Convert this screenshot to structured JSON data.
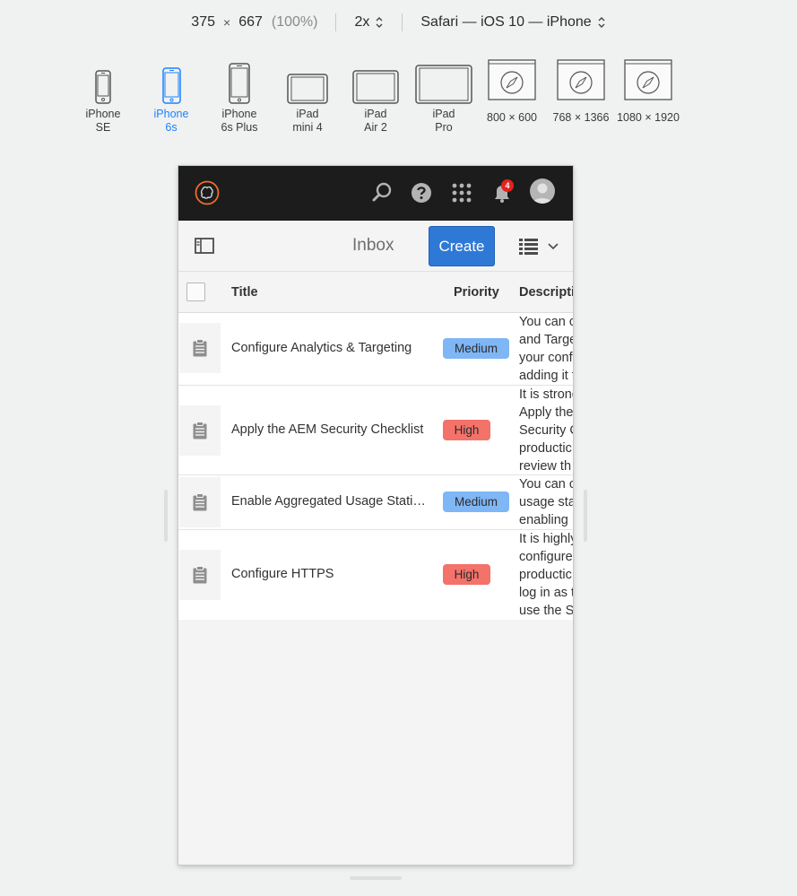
{
  "rdm": {
    "width": "375",
    "x": "×",
    "height": "667",
    "zoom": "(100%)",
    "pixel_ratio": "2x",
    "user_agent": "Safari — iOS 10 — iPhone"
  },
  "devices": [
    {
      "line1": "iPhone",
      "line2": "SE"
    },
    {
      "line1": "iPhone",
      "line2": "6s"
    },
    {
      "line1": "iPhone",
      "line2": "6s Plus"
    },
    {
      "line1": "iPad",
      "line2": "mini 4"
    },
    {
      "line1": "iPad",
      "line2": "Air 2"
    },
    {
      "line1": "iPad",
      "line2": "Pro"
    },
    {
      "line1": "800 × 600",
      "line2": ""
    },
    {
      "line1": "768 × 1366",
      "line2": ""
    },
    {
      "line1": "1080 × 1920",
      "line2": ""
    }
  ],
  "shell": {
    "notification_count": "4"
  },
  "actionbar": {
    "title": "Inbox",
    "create_label": "Create"
  },
  "table": {
    "headers": {
      "title": "Title",
      "priority": "Priority",
      "description": "Descripti"
    },
    "rows": [
      {
        "title": "Configure Analytics & Targeting",
        "priority": "Medium",
        "desc": [
          "You can c",
          "and Targe",
          "your conf",
          "adding it t"
        ]
      },
      {
        "title": "Apply the AEM Security Checklist",
        "priority": "High",
        "desc": [
          "It is strong",
          "Apply the",
          "Security C",
          "productic",
          "review th"
        ]
      },
      {
        "title": "Enable Aggregated Usage Statistic...",
        "priority": "Medium",
        "desc": [
          "You can c",
          "usage stat",
          "enabling"
        ]
      },
      {
        "title": "Configure HTTPS",
        "priority": "High",
        "desc": [
          "It is highly",
          "configure",
          "productic",
          "log in as t",
          "use the SS"
        ]
      }
    ]
  },
  "colors": {
    "active_device": "#1a82ff",
    "shell_bg": "#1c1c1c",
    "create_button": "#2f79d6",
    "medium": "#7fb6f5",
    "high": "#f3726a",
    "badge": "#e3231f"
  }
}
